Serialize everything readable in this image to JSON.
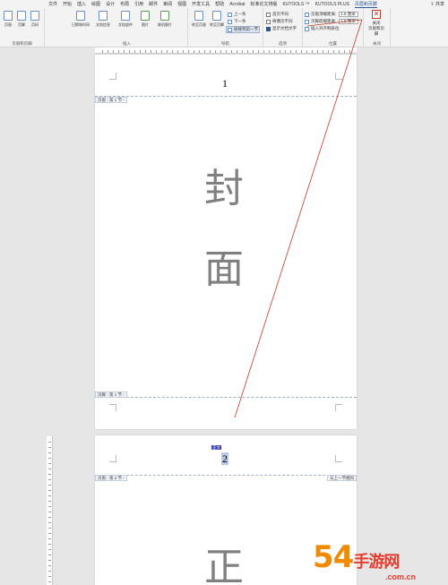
{
  "ribbon": {
    "tabs": [
      "文件",
      "开始",
      "插入",
      "绘图",
      "设计",
      "布局",
      "引用",
      "邮件",
      "审阅",
      "视图",
      "开发工具",
      "帮助",
      "Acrobat",
      "标准论文排版",
      "KUTOOLS ™",
      "KUTOOLS PLUS",
      "页眉和页脚"
    ],
    "active_tab": "页眉和页脚",
    "share_label": "共享",
    "groups": {
      "header_footer": {
        "label": "页眉和页脚",
        "buttons": [
          "页眉",
          "页脚",
          "页码"
        ]
      },
      "insert": {
        "label": "插入",
        "buttons": [
          "日期和时间",
          "文档信息",
          "文档部件",
          "图片",
          "联机图片"
        ]
      },
      "navigation": {
        "label": "导航",
        "buttons": [
          "转至页眉",
          "转至页脚"
        ],
        "items": [
          "上一条",
          "下一条",
          "链接到前一节"
        ]
      },
      "options": {
        "label": "选项",
        "items": [
          "首页不同",
          "奇偶页不同",
          "显示文档文字"
        ]
      },
      "position": {
        "label": "位置",
        "header_top_label": "页眉顶端距离:",
        "header_top_value": "1.5 厘米",
        "footer_bottom_label": "页脚底端距离:",
        "footer_bottom_value": "1.5 厘米",
        "align_tab_label": "插入对齐制表位"
      },
      "close": {
        "label": "关闭",
        "button": "关闭\n页眉和页脚"
      }
    }
  },
  "document": {
    "page1": {
      "page_number": "1",
      "header_tag": "页眉 - 第 1 节 -",
      "footer_tag": "页脚 - 第 1 节 -",
      "chars": [
        "封",
        "面"
      ]
    },
    "page2": {
      "page_number": "2",
      "tooltip": "正文",
      "header_tag": "页眉 - 第 2 节 -",
      "same_as_previous": "与上一节相同",
      "chars": [
        "正"
      ]
    }
  },
  "watermark": {
    "main": "54",
    "tail": "手游网",
    "sub": ".com.cn"
  },
  "colors": {
    "accent": "#2b579a",
    "annotation_red": "#c0392b",
    "char_gray": "#808080"
  }
}
